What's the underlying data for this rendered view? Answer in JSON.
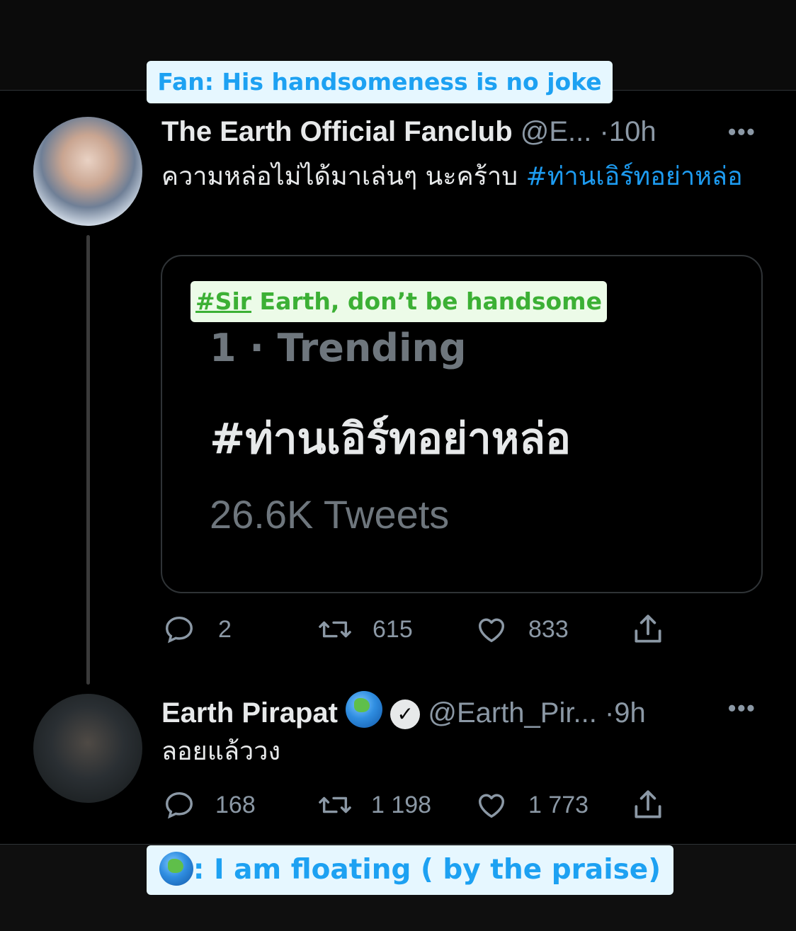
{
  "captions": {
    "top": "Fan: His handsomeness is no joke",
    "mid_tag": "#Sir",
    "mid_rest": " Earth, don’t be handsome",
    "bottom": ": I am floating ( by the praise)"
  },
  "tweet1": {
    "display_name": "The Earth Official Fanclub",
    "handle": "@E...",
    "separator": "·",
    "time": "10h",
    "more": "•••",
    "text": "ความหล่อไม่ได้มาเล่นๆ นะคร้าบ ",
    "hashtag": "#ท่านเอิร์ทอย่าหล่อ",
    "card": {
      "rank": "1 · Trending",
      "tag": "#ท่านเอิร์ทอย่าหล่อ",
      "count": "26.6K Tweets"
    },
    "actions": {
      "reply": "2",
      "retweet": "615",
      "like": "833"
    }
  },
  "tweet2": {
    "display_name": "Earth Pirapat",
    "verified": "✓",
    "handle": "@Earth_Pir...",
    "separator": "·",
    "time": "9h",
    "more": "•••",
    "text": "ลอยแล้ววง",
    "actions": {
      "reply": "168",
      "retweet": "1 198",
      "like": "1 773"
    }
  },
  "icons": {
    "reply": "reply-icon",
    "retweet": "retweet-icon",
    "like": "heart-icon",
    "share": "share-icon",
    "globe": "earth-globe-emoji"
  },
  "colors": {
    "link": "#1d9bf0",
    "muted": "#8b98a5",
    "caption_blue": "#1da1f2",
    "caption_green": "#3cb035"
  }
}
